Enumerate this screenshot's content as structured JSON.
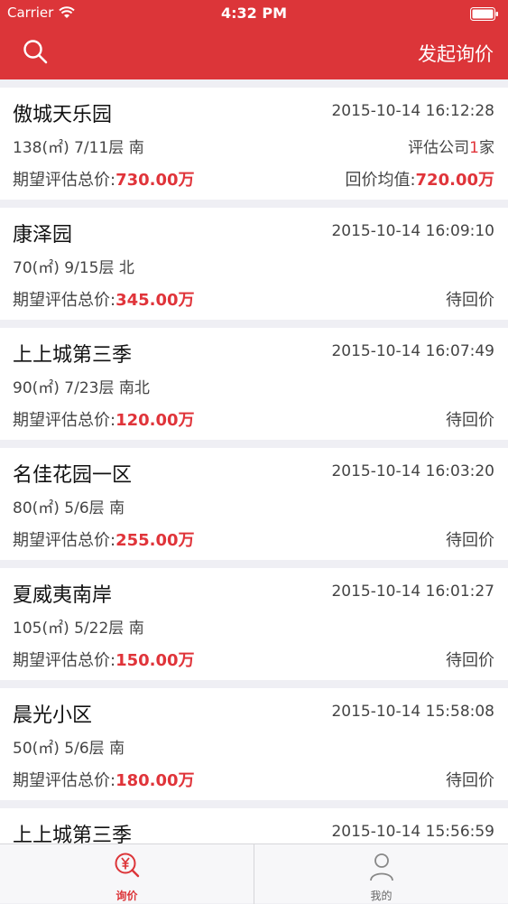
{
  "status_bar": {
    "carrier": "Carrier",
    "time": "4:32 PM"
  },
  "nav": {
    "action_label": "发起询价"
  },
  "labels": {
    "expected_price": "期望评估总价:",
    "company_prefix": "评估公司",
    "company_suffix": "家",
    "avg_reply": "回价均值:"
  },
  "listings": [
    {
      "name": "傲城天乐园",
      "time": "2015-10-14 16:12:28",
      "detail": "138(㎡) 7/11层 南",
      "expected": "730.00万",
      "company_count": "1",
      "avg": "720.00万",
      "status": ""
    },
    {
      "name": "康泽园",
      "time": "2015-10-14 16:09:10",
      "detail": "70(㎡) 9/15层 北",
      "expected": "345.00万",
      "status": "待回价"
    },
    {
      "name": "上上城第三季",
      "time": "2015-10-14 16:07:49",
      "detail": "90(㎡) 7/23层 南北",
      "expected": "120.00万",
      "status": "待回价"
    },
    {
      "name": "名佳花园一区",
      "time": "2015-10-14 16:03:20",
      "detail": "80(㎡) 5/6层 南",
      "expected": "255.00万",
      "status": "待回价"
    },
    {
      "name": "夏威夷南岸",
      "time": "2015-10-14 16:01:27",
      "detail": "105(㎡) 5/22层 南",
      "expected": "150.00万",
      "status": "待回价"
    },
    {
      "name": "晨光小区",
      "time": "2015-10-14 15:58:08",
      "detail": "50(㎡) 5/6层 南",
      "expected": "180.00万",
      "status": "待回价"
    },
    {
      "name": "上上城第三季",
      "time": "2015-10-14 15:56:59",
      "detail": "",
      "expected": "",
      "status": ""
    }
  ],
  "tabs": [
    {
      "label": "询价",
      "icon": "yuan-search-icon",
      "active": true
    },
    {
      "label": "我的",
      "icon": "user-icon",
      "active": false
    }
  ],
  "colors": {
    "brand": "#dc3539",
    "price": "#e0343a"
  }
}
